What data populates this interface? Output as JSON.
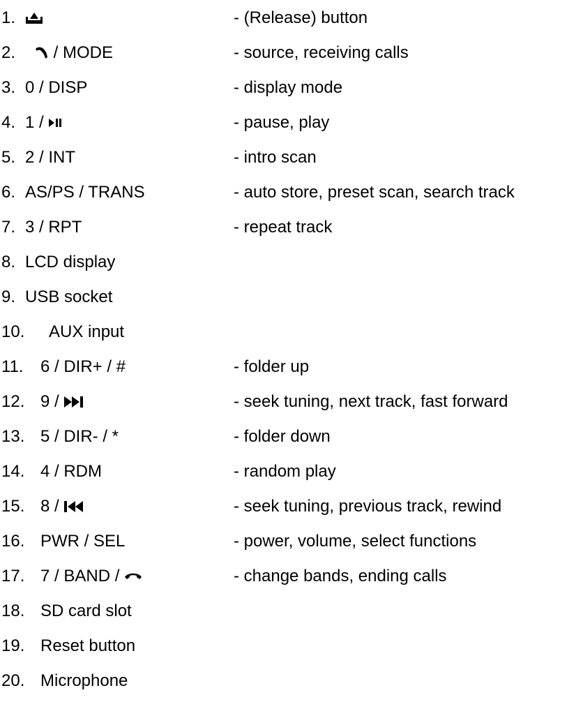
{
  "items": [
    {
      "num": "1.",
      "icon": "eject-icon",
      "label_suffix": "",
      "desc": "- (Release) button"
    },
    {
      "num": "2.",
      "icon": "phone-answer-icon",
      "label_suffix": " / MODE",
      "desc": "- source, receiving calls"
    },
    {
      "num": "3.",
      "label": "0 / DISP",
      "desc": "- display mode"
    },
    {
      "num": "4.",
      "label_prefix": "1 / ",
      "icon": "play-pause-icon",
      "desc": "- pause, play"
    },
    {
      "num": "5.",
      "label": "2 / INT",
      "desc": "- intro scan"
    },
    {
      "num": "6.",
      "label": "AS/PS / TRANS",
      "desc": "- auto store, preset scan, search track"
    },
    {
      "num": "7.",
      "label": "3 / RPT",
      "desc": "- repeat track"
    },
    {
      "num": "8.",
      "label": "LCD display",
      "desc": ""
    },
    {
      "num": "9.",
      "label": "USB socket",
      "desc": ""
    },
    {
      "num": "10.",
      "label": "AUX input",
      "desc": ""
    },
    {
      "num": "11.",
      "label": "6 / DIR+ / #",
      "desc": "- folder up"
    },
    {
      "num": "12.",
      "label_prefix": "9 / ",
      "icon": "next-track-icon",
      "desc": "- seek tuning, next track, fast forward"
    },
    {
      "num": "13.",
      "label": "5 / DIR- / *",
      "desc": "- folder down"
    },
    {
      "num": "14.",
      "label": "4 / RDM",
      "desc": "- random play"
    },
    {
      "num": "15.",
      "label_prefix": "8 / ",
      "icon": "previous-track-icon",
      "desc": "- seek tuning, previous track, rewind"
    },
    {
      "num": "16.",
      "label": "PWR / SEL",
      "desc": "- power, volume, select functions"
    },
    {
      "num": "17.",
      "label_prefix": "7 / BAND / ",
      "icon": "phone-hangup-icon",
      "desc": "- change bands, ending calls"
    },
    {
      "num": "18.",
      "label": "SD card slot",
      "desc": ""
    },
    {
      "num": "19.",
      "label": "Reset button",
      "desc": ""
    },
    {
      "num": "20.",
      "label": "Microphone",
      "desc": ""
    }
  ],
  "colors": {
    "text": "#000000",
    "background": "#ffffff"
  }
}
